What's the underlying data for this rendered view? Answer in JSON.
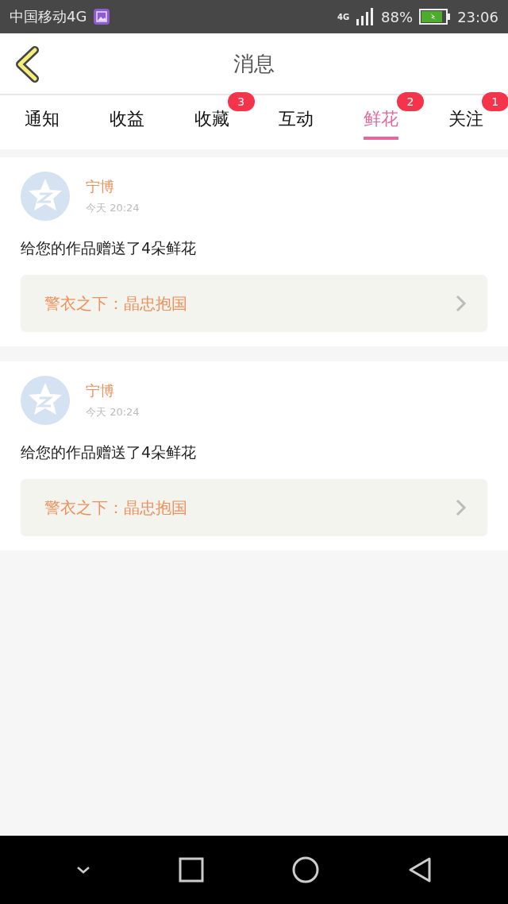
{
  "status_bar": {
    "carrier": "中国移动4G",
    "network": "4G",
    "battery": "88%",
    "time": "23:06"
  },
  "header": {
    "title": "消息"
  },
  "tabs": [
    {
      "label": "通知",
      "selected": false
    },
    {
      "label": "收益",
      "selected": false
    },
    {
      "label": "收藏",
      "selected": false,
      "badge": "3"
    },
    {
      "label": "互动",
      "selected": false
    },
    {
      "label": "鲜花",
      "selected": true,
      "badge": "2"
    },
    {
      "label": "关注",
      "selected": false,
      "badge": "1"
    }
  ],
  "messages": [
    {
      "sender": "宁博",
      "time": "今天  20:24",
      "text": "给您的作品赠送了4朵鲜花",
      "work": "警衣之下：晶忠抱国"
    },
    {
      "sender": "宁博",
      "time": "今天  20:24",
      "text": "给您的作品赠送了4朵鲜花",
      "work": "警衣之下：晶忠抱国"
    }
  ]
}
